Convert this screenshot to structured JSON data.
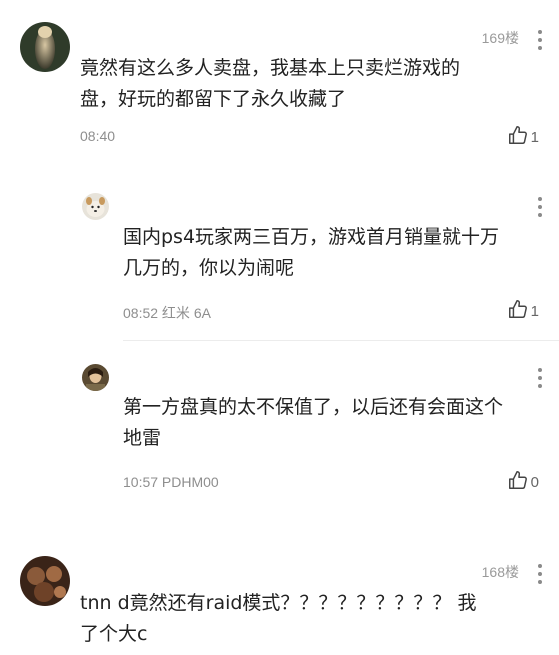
{
  "comments": [
    {
      "floor": "169楼",
      "text": "竟然有这么多人卖盘，我基本上只卖烂游戏的\n盘，好玩的都留下了永久收藏了",
      "meta": "08:40",
      "likes": "1",
      "replies": [
        {
          "text": "国内ps4玩家两三百万，游戏首月销量就十万\n几万的，你以为闹呢",
          "meta": "08:52 红米 6A",
          "likes": "1"
        },
        {
          "text": "第一方盘真的太不保值了，以后还有会面这个\n地雷",
          "meta": "10:57 PDHM00",
          "likes": "0"
        }
      ]
    },
    {
      "floor": "168楼",
      "text": "tnn d竟然还有raid模式？？？？？？？？？ 我\n了个大c"
    }
  ],
  "icons": {
    "like": "thumbs-up-icon",
    "more": "more-vertical-icon"
  },
  "colors": {
    "text": "#222222",
    "meta": "#8e8e8e",
    "divider": "#ececec"
  }
}
